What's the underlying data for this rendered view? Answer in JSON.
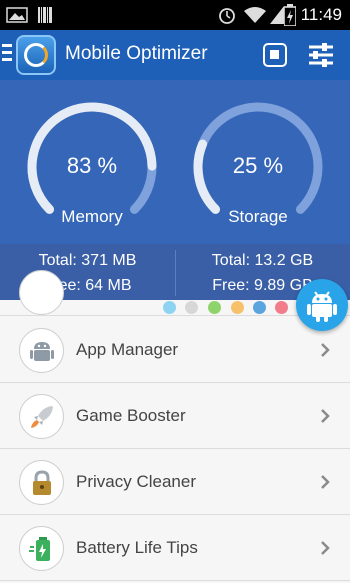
{
  "status_bar": {
    "time": "11:49"
  },
  "app_bar": {
    "title": "Mobile Optimizer",
    "stop_icon": "stop-square-icon",
    "settings_icon": "sliders-icon"
  },
  "stats": {
    "memory": {
      "percent_label": "83 %",
      "percent": 83,
      "label": "Memory",
      "total": "Total: 371 MB",
      "free": "Free: 64 MB"
    },
    "storage": {
      "percent_label": "25 %",
      "percent": 25,
      "label": "Storage",
      "total": "Total: 13.2 GB",
      "free": "Free: 9.89 GB"
    }
  },
  "colors": {
    "app_bar": "#1e5fb7",
    "panel": "#3566b8",
    "gauge_track": "#e6ecf5",
    "gauge_fill": "#7fa2dc",
    "dots": [
      "#8fd3f2",
      "#d7d7d7",
      "#8fd46a",
      "#f7c16b",
      "#5aa5dd",
      "#f37c8a"
    ]
  },
  "menu": {
    "items": [
      {
        "label": "App Manager",
        "icon": "android-icon"
      },
      {
        "label": "Game Booster",
        "icon": "rocket-icon"
      },
      {
        "label": "Privacy Cleaner",
        "icon": "lock-icon"
      },
      {
        "label": "Battery Life Tips",
        "icon": "battery-icon"
      }
    ]
  }
}
